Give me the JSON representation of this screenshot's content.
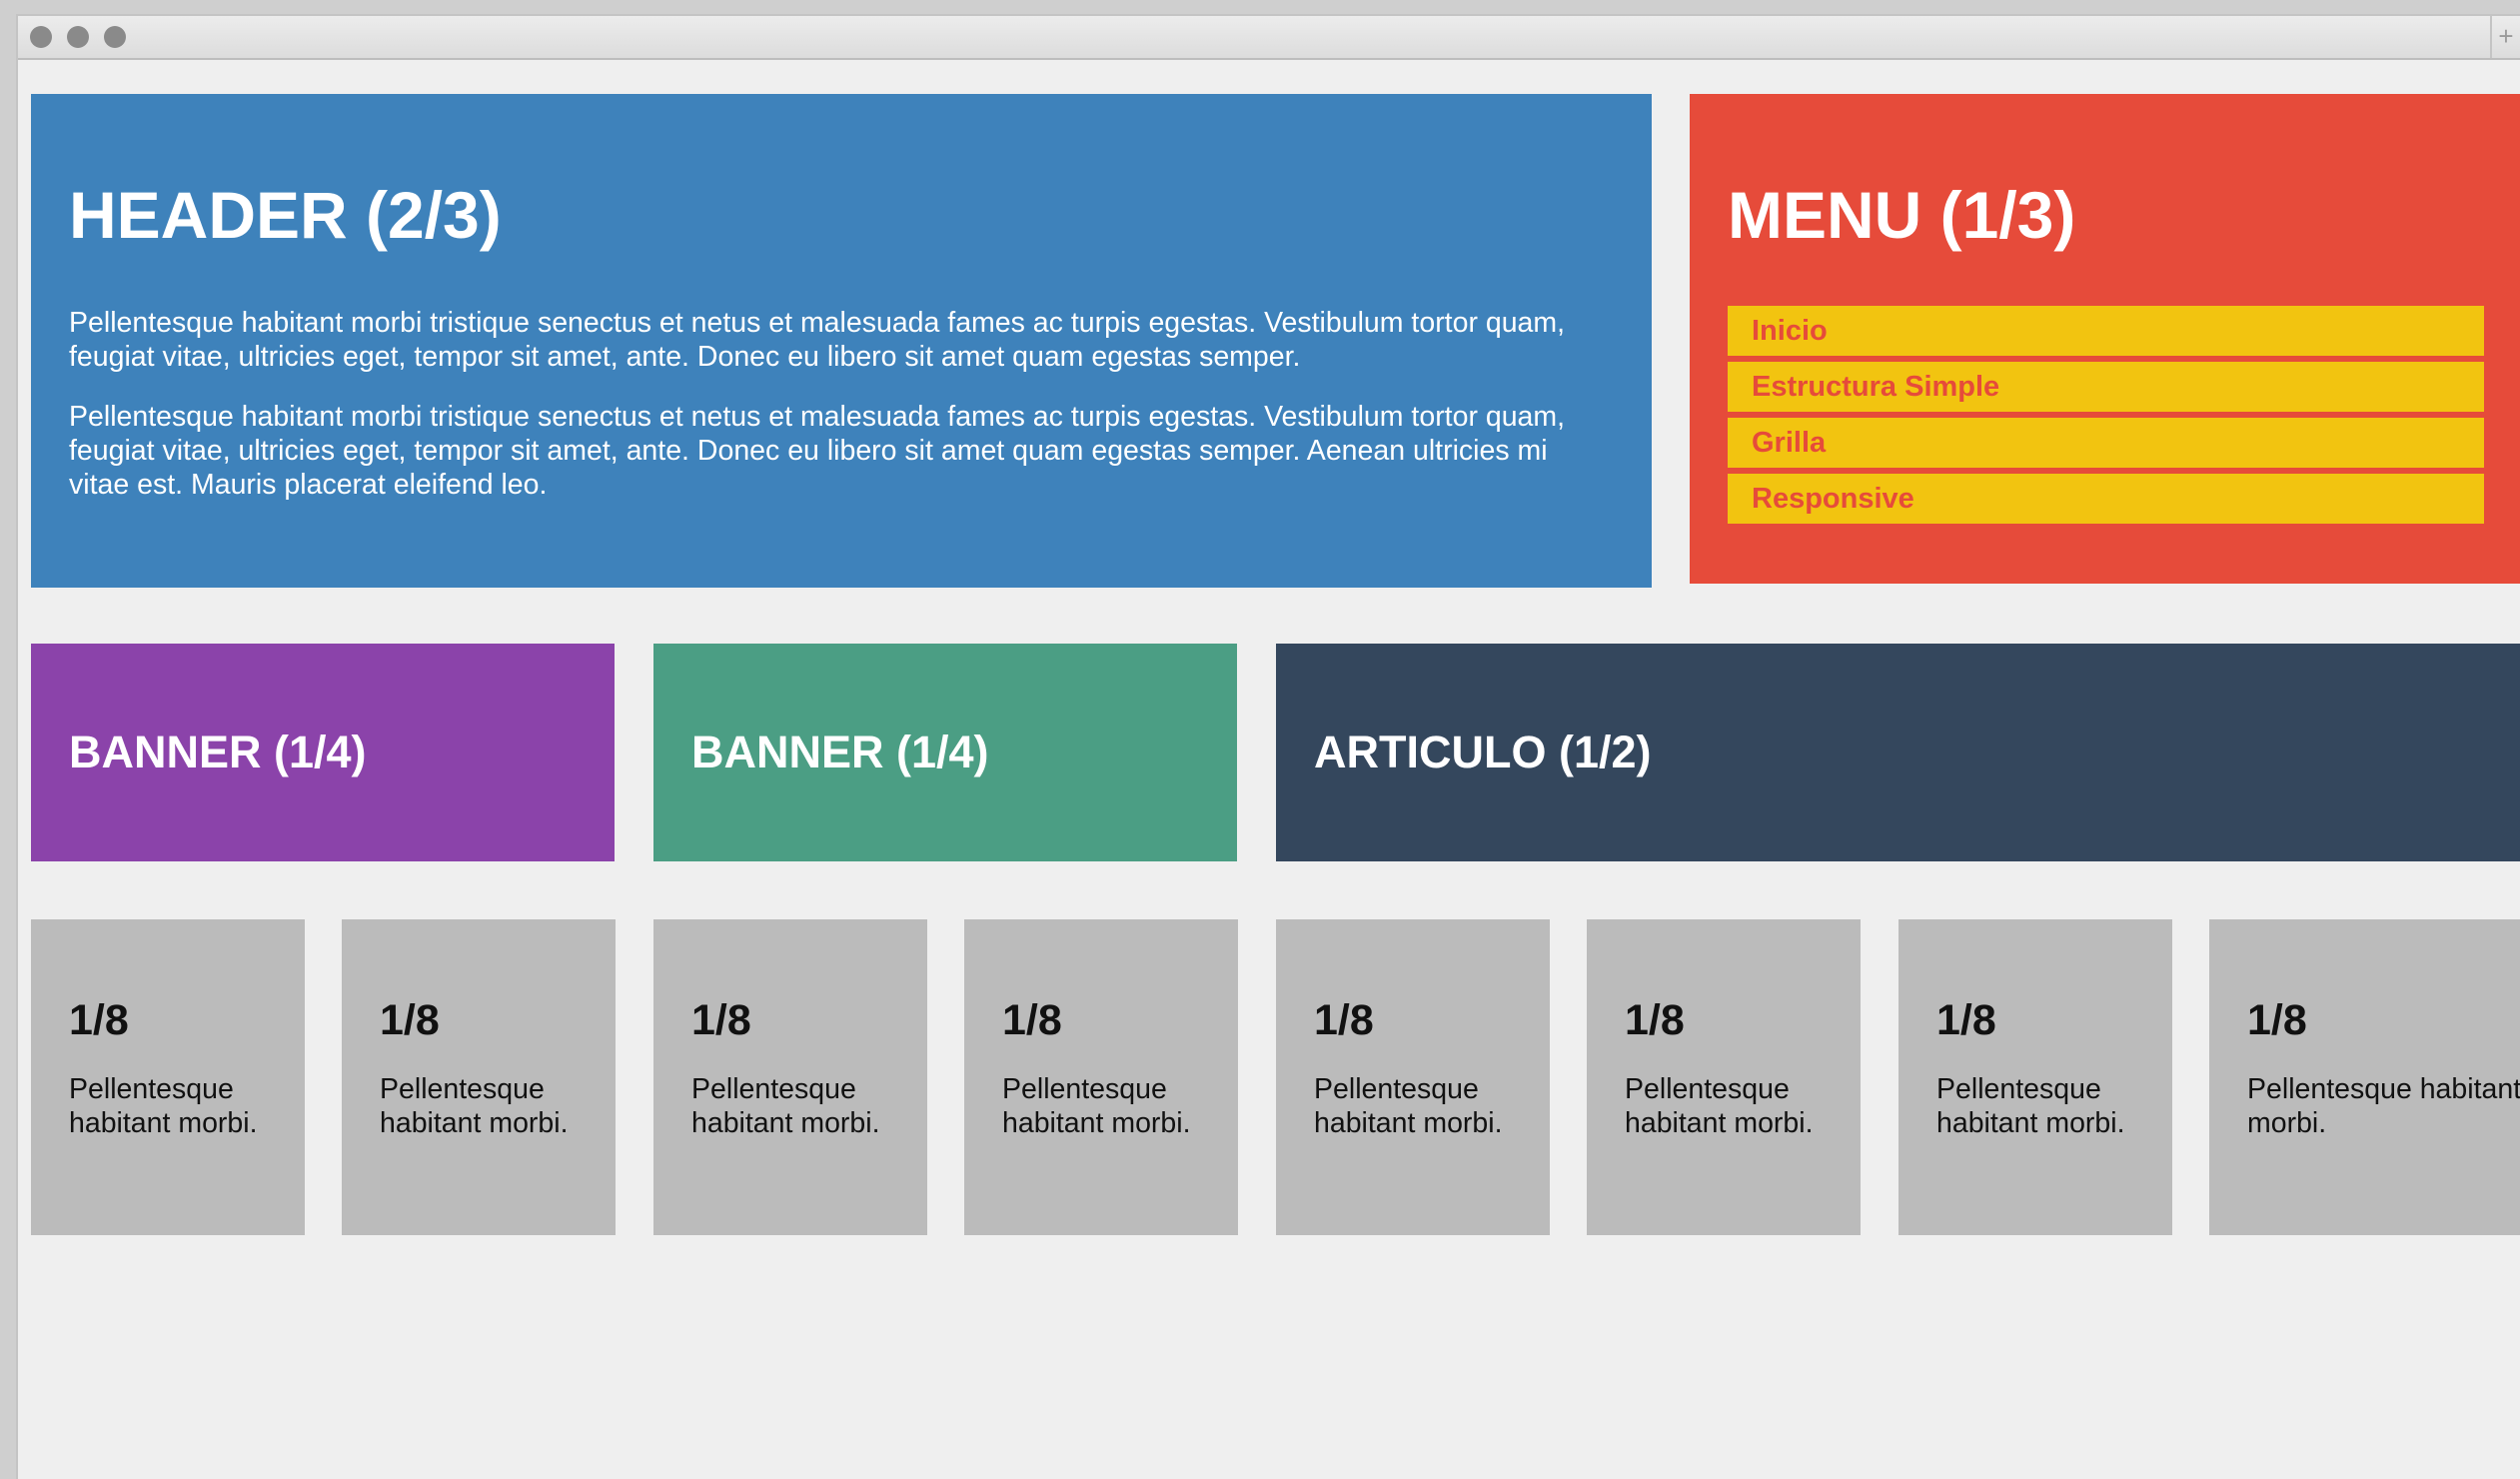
{
  "window": {
    "controls": [
      "close",
      "minimize",
      "zoom"
    ],
    "new_tab_label": "+"
  },
  "header": {
    "title": "HEADER (2/3)",
    "paragraphs": [
      "Pellentesque habitant morbi tristique senectus et netus et malesuada fames ac turpis egestas. Vestibulum tortor quam, feugiat vitae, ultricies eget, tempor sit amet, ante. Donec eu libero sit amet quam egestas semper.",
      "Pellentesque habitant morbi tristique senectus et netus et malesuada fames ac turpis egestas. Vestibulum tortor quam, feugiat vitae, ultricies eget, tempor sit amet, ante. Donec eu libero sit amet quam egestas semper. Aenean ultricies mi vitae est. Mauris placerat eleifend leo."
    ]
  },
  "menu": {
    "title": "MENU (1/3)",
    "items": [
      {
        "label": "Inicio"
      },
      {
        "label": "Estructura Simple"
      },
      {
        "label": "Grilla"
      },
      {
        "label": "Responsive"
      }
    ]
  },
  "banners": [
    {
      "title": "BANNER (1/4)",
      "color": "#8b43aa"
    },
    {
      "title": "BANNER (1/4)",
      "color": "#4b9e84"
    }
  ],
  "article": {
    "title": "ARTICULO (1/2)",
    "color": "#34475d"
  },
  "columns": [
    {
      "title": "1/8",
      "text": "Pellentesque habitant morbi."
    },
    {
      "title": "1/8",
      "text": "Pellentesque habitant morbi."
    },
    {
      "title": "1/8",
      "text": "Pellentesque habitant morbi."
    },
    {
      "title": "1/8",
      "text": "Pellentesque habitant morbi."
    },
    {
      "title": "1/8",
      "text": "Pellentesque habitant morbi."
    },
    {
      "title": "1/8",
      "text": "Pellentesque habitant morbi."
    },
    {
      "title": "1/8",
      "text": "Pellentesque habitant morbi."
    },
    {
      "title": "1/8",
      "text": "Pellentesque habitant morbi."
    }
  ],
  "colors": {
    "header": "#3e82bb",
    "menu": "#e64b3a",
    "menu_item": "#f2c410",
    "column": "#bbbbbb",
    "page_background": "#efefef"
  }
}
